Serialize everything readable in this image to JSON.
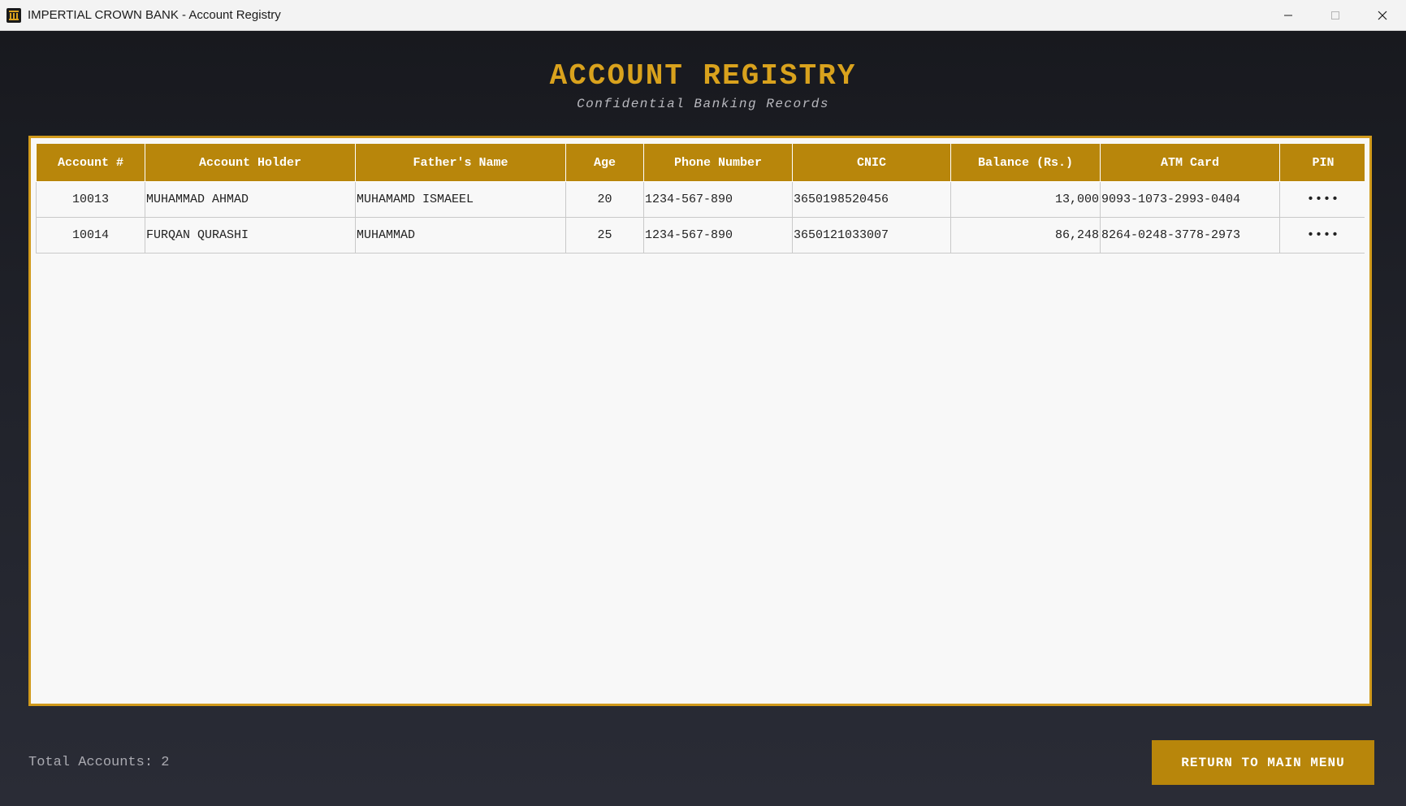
{
  "window": {
    "title": "IMPERTIAL CROWN BANK - Account Registry",
    "app_icon": "bank-building-icon",
    "controls": [
      "minimize-icon",
      "maximize-icon",
      "close-icon"
    ]
  },
  "header": {
    "title": "ACCOUNT REGISTRY",
    "subtitle": "Confidential Banking Records"
  },
  "table": {
    "columns": [
      "Account #",
      "Account Holder",
      "Father's Name",
      "Age",
      "Phone Number",
      "CNIC",
      "Balance (Rs.)",
      "ATM Card",
      "PIN"
    ],
    "rows": [
      {
        "account": "10013",
        "holder": "MUHAMMAD AHMAD",
        "father": "MUHAMAMD ISMAEEL",
        "age": "20",
        "phone": "1234-567-890",
        "cnic": "3650198520456",
        "balance": "13,000",
        "atm": "9093-1073-2993-0404",
        "pin": "••••"
      },
      {
        "account": "10014",
        "holder": "FURQAN QURASHI",
        "father": "MUHAMMAD",
        "age": "25",
        "phone": "1234-567-890",
        "cnic": "3650121033007",
        "balance": "86,248",
        "atm": "8264-0248-3778-2973",
        "pin": "••••"
      }
    ]
  },
  "footer": {
    "total_accounts": "Total Accounts: 2",
    "return_button": "RETURN TO MAIN MENU"
  },
  "colors": {
    "accent": "#d19a1c",
    "header_bg": "#b8860b",
    "title": "#d9a21d",
    "background": "#1e2028"
  }
}
